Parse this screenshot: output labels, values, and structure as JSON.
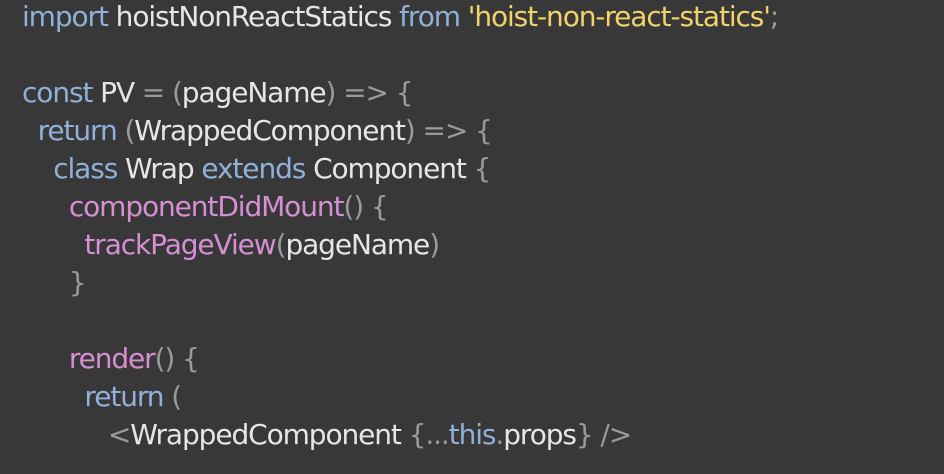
{
  "code": {
    "lines": [
      {
        "tokens": [
          "import",
          " ",
          "hoistNonReactStatics",
          " ",
          "from",
          " ",
          "'hoist-non-react-statics'",
          ";"
        ]
      },
      {
        "tokens": []
      },
      {
        "tokens": [
          "const",
          " ",
          "PV",
          " = ",
          "(",
          "pageName",
          ") => {"
        ]
      },
      {
        "tokens": [
          "  ",
          "return",
          " ",
          "(",
          "WrappedComponent",
          ") => {"
        ]
      },
      {
        "tokens": [
          "    ",
          "class",
          " ",
          "Wrap",
          " ",
          "extends",
          " ",
          "Component",
          " {"
        ]
      },
      {
        "tokens": [
          "      ",
          "componentDidMount",
          "() {"
        ]
      },
      {
        "tokens": [
          "        ",
          "trackPageView",
          "(",
          "pageName",
          ")"
        ]
      },
      {
        "tokens": [
          "      ",
          "}"
        ]
      },
      {
        "tokens": []
      },
      {
        "tokens": [
          "      ",
          "render",
          "() {"
        ]
      },
      {
        "tokens": [
          "        ",
          "return",
          " ("
        ]
      },
      {
        "tokens": [
          "           ",
          "<",
          "WrappedComponent",
          " {",
          "...",
          "this",
          ".",
          "props",
          "} />"
        ]
      }
    ]
  }
}
